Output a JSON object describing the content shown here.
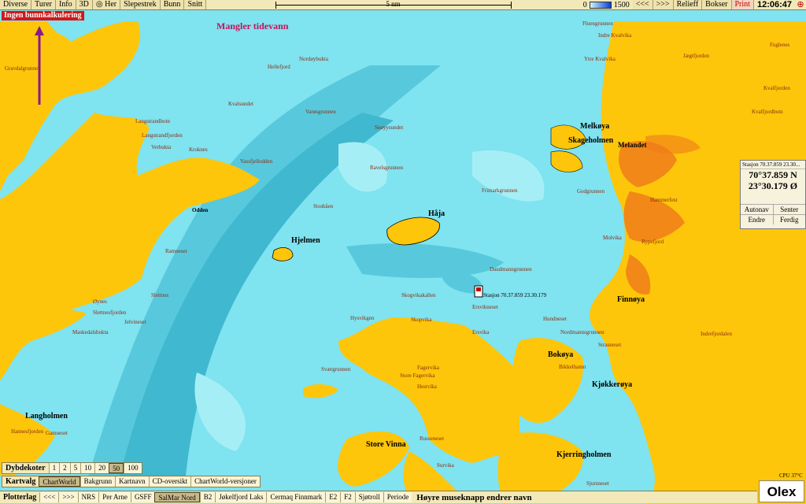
{
  "menu": {
    "left": [
      "Diverse",
      "Turer",
      "Info",
      "3D"
    ],
    "her": "Her",
    "mid": [
      "Slepestrek",
      "Bunn",
      "Snitt"
    ],
    "scale_label": "5 nm",
    "depth_min": "0",
    "depth_max": "1500",
    "nav": [
      "<<<",
      ">>>"
    ],
    "right": [
      "Relieff",
      "Bokser",
      "Print"
    ],
    "clock": "12:06:47"
  },
  "warning": "Ingen bunnkalkulering",
  "tide_notice": "Mangler tidevann",
  "position": {
    "header": "Stasjon 70.37.859 23.30...",
    "lat": "70°37.859 N",
    "lon": "23°30.179 Ø",
    "buttons1": [
      "Autonav",
      "Senter"
    ],
    "buttons2": [
      "Endre",
      "Ferdig"
    ]
  },
  "places_major": [
    "Melkøya",
    "Skageholmen",
    "Melandet",
    "Håja",
    "Hjelmen",
    "Finnøya",
    "Bokøya",
    "Kjøkkerøya",
    "Langholmen",
    "Store Vinna",
    "Kjerringholmen"
  ],
  "places_minor": [
    "Nordøybukta",
    "Hellefjord",
    "Varøsgrunnen",
    "Snøyysundet",
    "Ravelsgrunnen",
    "Stosbåen",
    "Frimarkgrunnen",
    "Godgrunnen",
    "Daudmanngrunnen",
    "Skogvikakallen",
    "Ersvikneset",
    "Ersvika",
    "Hundneset",
    "Hammerfest",
    "Rypefjord",
    "Molvika",
    "Fuglenes",
    "Fluengrunnen",
    "Ytre Kvalvika",
    "Indre Kvalvika",
    "Jægtfjorden",
    "Kvalfjorden",
    "Kvalfjordbotn",
    "Indrefjordalen",
    "Nordmannsgrunnen",
    "Strauneset",
    "Kroknes",
    "Odden",
    "Ramneset",
    "Slettnes",
    "Slettnesfjorden",
    "Jelvineset",
    "Øynes",
    "Maskedalsbukta",
    "Gamneset",
    "Hannesfjorden",
    "Sværgrunnen",
    "Store Fagervika",
    "Fagervika",
    "Hestvika",
    "Russeneset",
    "Survika",
    "Hysvikgen",
    "Skopvika",
    "Langstrandfjorden",
    "Langstrandbotn",
    "Verbukta",
    "Vassfjellodden",
    "Kvalsundet",
    "Gravdalgrunnen",
    "Bikkelhamn",
    "Sjursneset"
  ],
  "station_label": "Stasjon 70.37.859 23.30.179",
  "depth_bar": {
    "label": "Dybdekoter",
    "options": [
      "1",
      "2",
      "5",
      "10",
      "20",
      "50",
      "100"
    ],
    "selected": "50"
  },
  "kartvalg": {
    "label": "Kartvalg",
    "options": [
      "ChartWorld",
      "Bakgrunn",
      "Kartnavn",
      "CD-oversikt",
      "ChartWorld-versjoner"
    ],
    "selected": "ChartWorld"
  },
  "plotter": {
    "label": "Plotterlag",
    "items": [
      "<<<",
      ">>>",
      "NRS",
      "Per Arne",
      "GSFF",
      "SalMar Nord",
      "B2",
      "Jøkelfjord Laks",
      "Cermaq Finnmark",
      "E2",
      "F2",
      "Sjøtroll",
      "Periode"
    ],
    "selected": "SalMar Nord",
    "hint": "Høyre museknapp endrer navn"
  },
  "brand": "Olex",
  "cpu": "CPU 37°C",
  "colors": {
    "land": "#fdc60a",
    "shallow": "#7fe3f0",
    "deep": "#4ec3d6",
    "deeper": "#33aec6",
    "infra": "#f07c1a"
  }
}
